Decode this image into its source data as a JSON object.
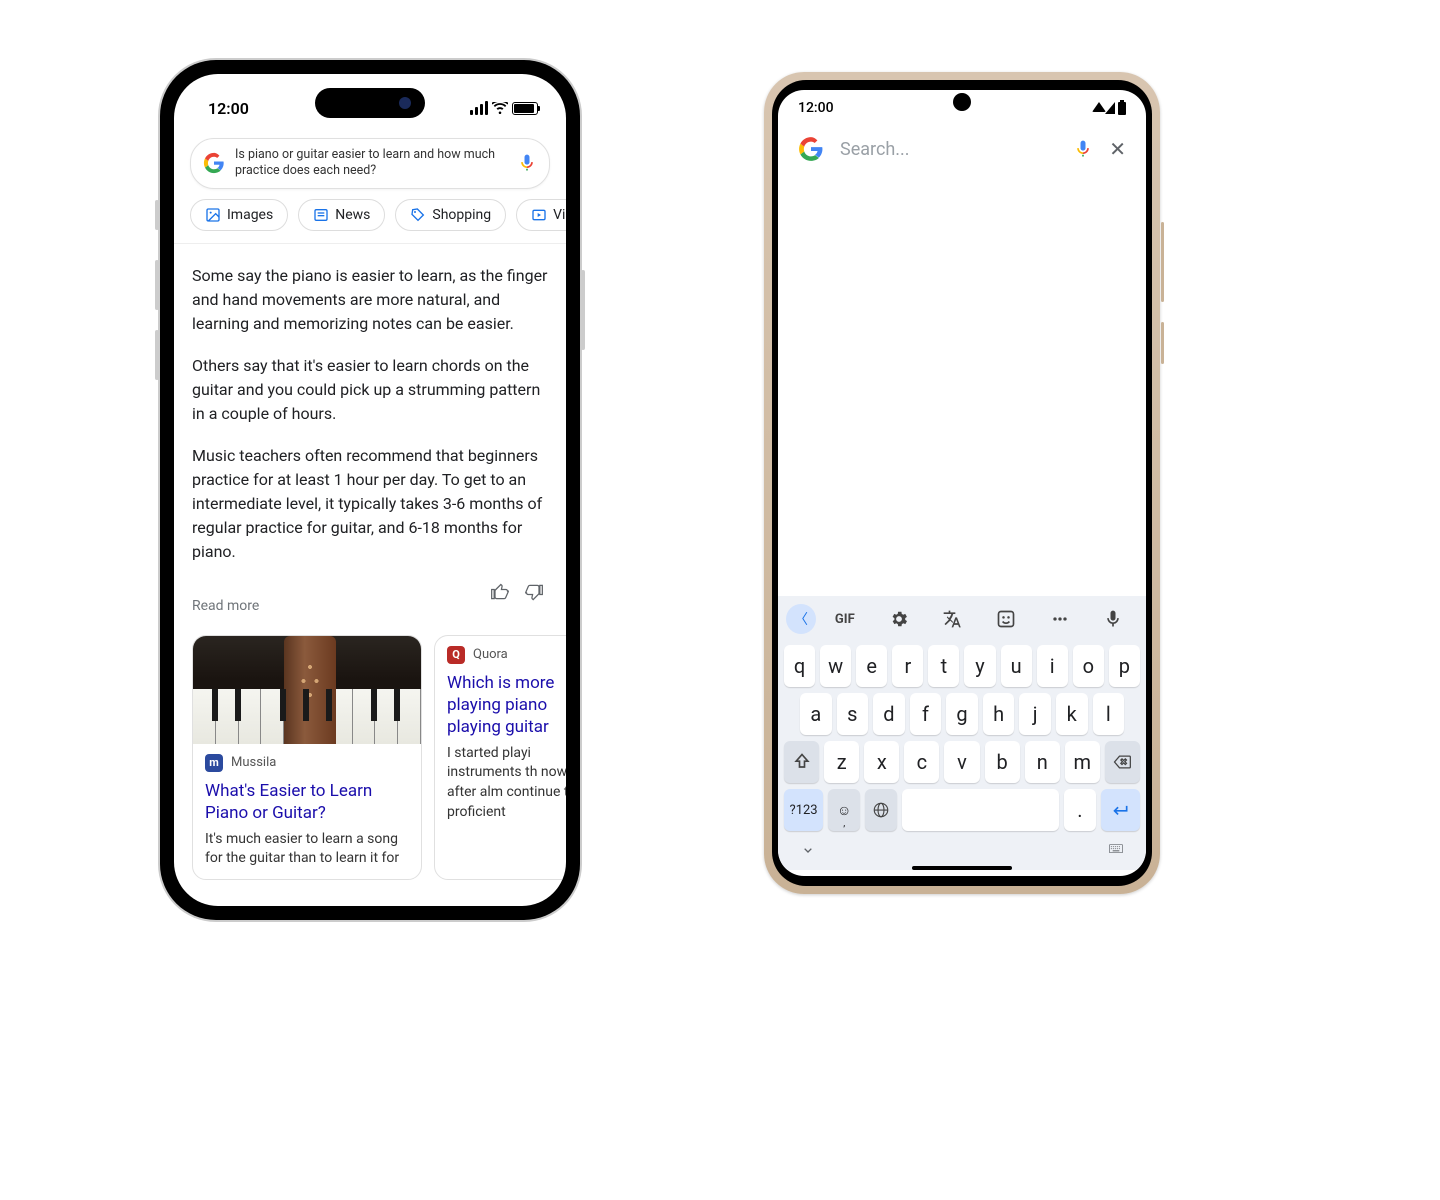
{
  "iphone": {
    "time": "12:00",
    "search_query": "Is piano or guitar easier to learn and how much practice does each need?",
    "chips": [
      {
        "icon": "images",
        "label": "Images"
      },
      {
        "icon": "news",
        "label": "News"
      },
      {
        "icon": "shopping",
        "label": "Shopping"
      },
      {
        "icon": "videos",
        "label": "Vid"
      }
    ],
    "answer": {
      "p1": "Some say the piano is easier to learn, as the finger and hand movements are more natural, and learning and memorizing notes can be easier.",
      "p2": "Others say that it's easier to learn chords on the guitar and you could pick up a strumming pattern in a couple of hours.",
      "p3": "Music teachers often recommend that beginners practice for at least 1 hour per day. To get to an intermediate level, it typically takes 3-6 months of regular practice for guitar, and 6-18 months for piano."
    },
    "read_more": "Read more",
    "cards": [
      {
        "source": "Mussila",
        "title": "What's Easier to Learn Piano or Guitar?",
        "snippet": "It's much easier to learn a song for the guitar than to learn it for"
      },
      {
        "source": "Quora",
        "title": "Which is more playing piano playing guitar",
        "snippet": "I started playi instruments th now, after alm continue to d proficient"
      }
    ]
  },
  "android": {
    "time": "12:00",
    "search_placeholder": "Search...",
    "suggest_bar": {
      "gif": "GIF"
    },
    "keyboard": {
      "row1": [
        "q",
        "w",
        "e",
        "r",
        "t",
        "y",
        "u",
        "i",
        "o",
        "p"
      ],
      "row2": [
        "a",
        "s",
        "d",
        "f",
        "g",
        "h",
        "j",
        "k",
        "l"
      ],
      "row3": [
        "z",
        "x",
        "c",
        "v",
        "b",
        "n",
        "m"
      ],
      "num_key": "?123",
      "dot_key": "."
    }
  }
}
